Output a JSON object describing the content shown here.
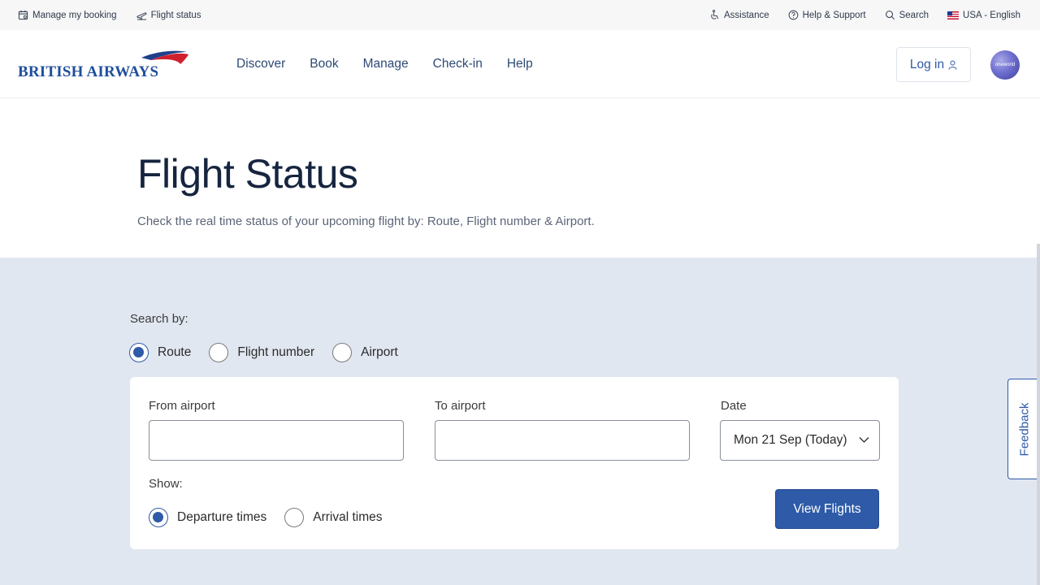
{
  "utility_bar": {
    "manage_booking": "Manage my booking",
    "flight_status": "Flight status",
    "assistance": "Assistance",
    "help_support": "Help & Support",
    "search": "Search",
    "locale": "USA - English"
  },
  "header": {
    "logo_text": "BRITISH AIRWAYS",
    "nav": [
      "Discover",
      "Book",
      "Manage",
      "Check-in",
      "Help"
    ],
    "login_label": "Log in",
    "oneworld_label": "oneworld"
  },
  "page": {
    "title": "Flight Status",
    "subtitle": "Check the real time status of your upcoming flight by: Route, Flight number & Airport."
  },
  "search": {
    "search_by_label": "Search by:",
    "options": [
      "Route",
      "Flight number",
      "Airport"
    ],
    "selected_option": "Route",
    "from_label": "From airport",
    "from_value": "",
    "to_label": "To airport",
    "to_value": "",
    "date_label": "Date",
    "date_value": "Mon 21 Sep (Today)",
    "show_label": "Show:",
    "show_options": [
      "Departure times",
      "Arrival times"
    ],
    "selected_show": "Departure times",
    "submit_label": "View Flights"
  },
  "feedback_label": "Feedback",
  "colors": {
    "brand_blue": "#2e5aa8",
    "panel_bg": "#e1e7f1",
    "title_navy": "#16253f"
  }
}
